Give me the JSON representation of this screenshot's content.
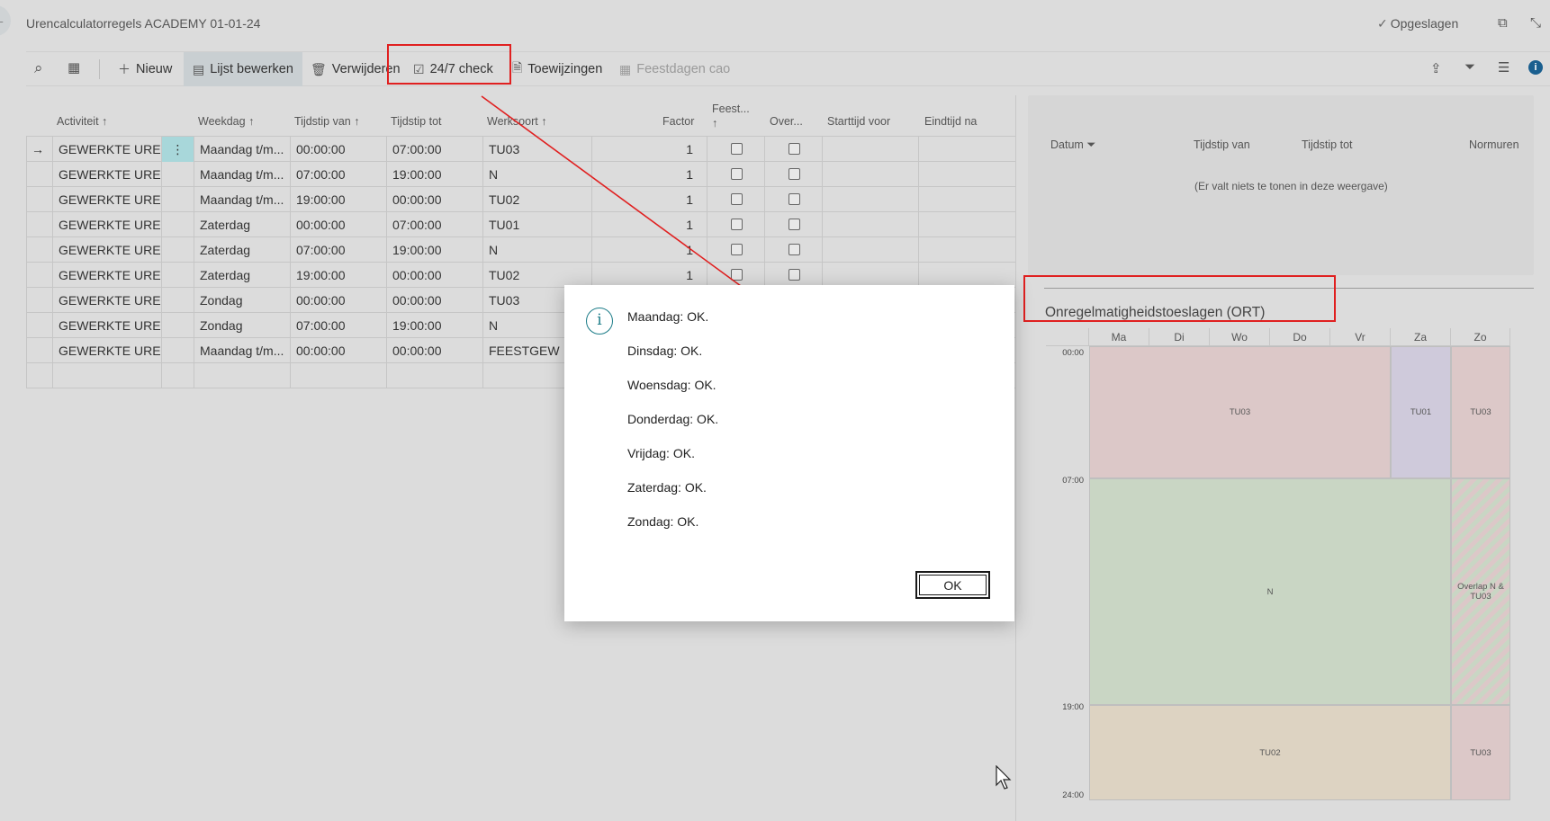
{
  "window": {
    "title": "Urencalculatorregels ACADEMY 01-01-24",
    "saved_label": "Opgeslagen"
  },
  "toolbar": {
    "new_label": "Nieuw",
    "edit_list_label": "Lijst bewerken",
    "delete_label": "Verwijderen",
    "check_label": "24/7 check",
    "assignments_label": "Toewijzingen",
    "holidays_label": "Feestdagen cao"
  },
  "grid": {
    "headers": {
      "activiteit": "Activiteit",
      "weekdag": "Weekdag",
      "tijdstip_van": "Tijdstip van",
      "tijdstip_tot": "Tijdstip tot",
      "werksoort": "Werksoort",
      "factor": "Factor",
      "feest_line1": "Feest...",
      "over": "Over...",
      "starttijd_voor": "Starttijd voor",
      "eindtijd_na": "Eindtijd na"
    },
    "rows": [
      {
        "activiteit": "GEWERKTE UREN",
        "weekdag": "Maandag t/m...",
        "van": "00:00:00",
        "tot": "07:00:00",
        "werksoort": "TU03",
        "factor": "1"
      },
      {
        "activiteit": "GEWERKTE UREN",
        "weekdag": "Maandag t/m...",
        "van": "07:00:00",
        "tot": "19:00:00",
        "werksoort": "N",
        "factor": "1"
      },
      {
        "activiteit": "GEWERKTE UREN",
        "weekdag": "Maandag t/m...",
        "van": "19:00:00",
        "tot": "00:00:00",
        "werksoort": "TU02",
        "factor": "1"
      },
      {
        "activiteit": "GEWERKTE UREN",
        "weekdag": "Zaterdag",
        "van": "00:00:00",
        "tot": "07:00:00",
        "werksoort": "TU01",
        "factor": "1"
      },
      {
        "activiteit": "GEWERKTE UREN",
        "weekdag": "Zaterdag",
        "van": "07:00:00",
        "tot": "19:00:00",
        "werksoort": "N",
        "factor": "1"
      },
      {
        "activiteit": "GEWERKTE UREN",
        "weekdag": "Zaterdag",
        "van": "19:00:00",
        "tot": "00:00:00",
        "werksoort": "TU02",
        "factor": "1"
      },
      {
        "activiteit": "GEWERKTE UREN",
        "weekdag": "Zondag",
        "van": "00:00:00",
        "tot": "00:00:00",
        "werksoort": "TU03",
        "factor": ""
      },
      {
        "activiteit": "GEWERKTE UREN",
        "weekdag": "Zondag",
        "van": "07:00:00",
        "tot": "19:00:00",
        "werksoort": "N",
        "factor": ""
      },
      {
        "activiteit": "GEWERKTE UREN",
        "weekdag": "Maandag t/m...",
        "van": "00:00:00",
        "tot": "00:00:00",
        "werksoort": "FEESTGEW",
        "factor": ""
      }
    ]
  },
  "holidays_panel": {
    "headers": {
      "datum": "Datum",
      "van": "Tijdstip van",
      "tot": "Tijdstip tot",
      "normuren": "Normuren"
    },
    "empty_message": "(Er valt niets te tonen in deze weergave)"
  },
  "ort": {
    "title": "Onregelmatigheidstoeslagen (ORT)",
    "days": [
      "Ma",
      "Di",
      "Wo",
      "Do",
      "Vr",
      "Za",
      "Zo"
    ],
    "times": [
      "00:00",
      "07:00",
      "19:00",
      "24:00"
    ],
    "blocks": {
      "tu03_week": "TU03",
      "tu01_sat": "TU01",
      "tu03_sun": "TU03",
      "n_week": "N",
      "overlap_sun": "Overlap N & TU03",
      "tu02_week": "TU02",
      "tu03_sun_evening": "TU03"
    },
    "colors": {
      "tu03": "#dcc8c8",
      "tu01": "#cfcadb",
      "n": "#c9d6c4",
      "tu02": "#ddd3c2"
    }
  },
  "dialog": {
    "messages": [
      "Maandag: OK.",
      "Dinsdag: OK.",
      "Woensdag: OK.",
      "Donderdag: OK.",
      "Vrijdag: OK.",
      "Zaterdag: OK.",
      "Zondag: OK."
    ],
    "ok_label": "OK"
  }
}
